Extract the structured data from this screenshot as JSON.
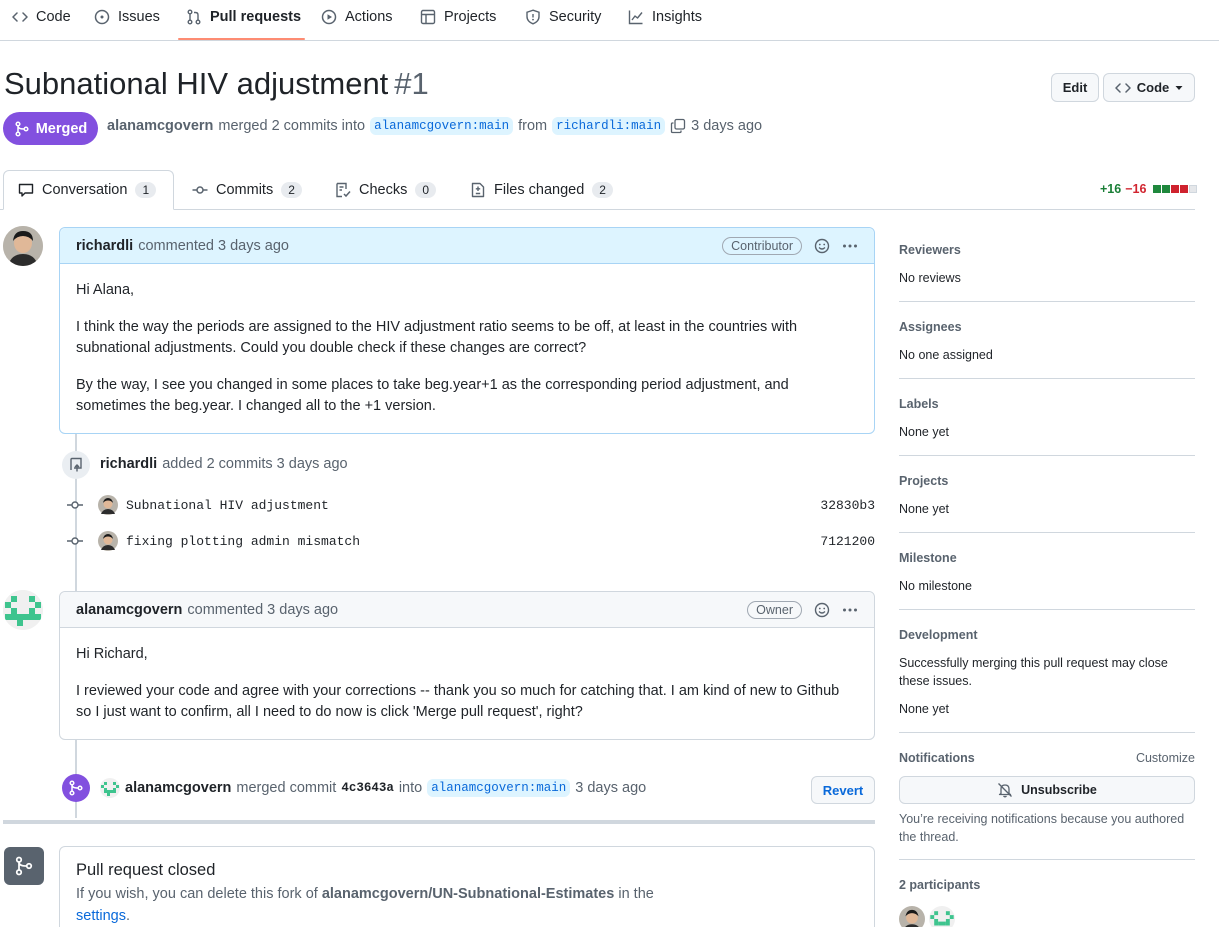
{
  "nav": {
    "items": [
      {
        "label": "Code",
        "icon": "code-icon"
      },
      {
        "label": "Issues",
        "icon": "issue-icon"
      },
      {
        "label": "Pull requests",
        "icon": "pull-request-icon",
        "active": true
      },
      {
        "label": "Actions",
        "icon": "play-icon"
      },
      {
        "label": "Projects",
        "icon": "table-icon"
      },
      {
        "label": "Security",
        "icon": "shield-icon"
      },
      {
        "label": "Insights",
        "icon": "graph-icon"
      }
    ]
  },
  "pr": {
    "title": "Subnational HIV adjustment",
    "number": "#1",
    "edit_label": "Edit",
    "code_label": "Code",
    "state_label": "Merged",
    "author": "alanamcgovern",
    "merge_text": "merged 2 commits into",
    "base_branch": "alanamcgovern:main",
    "from_text": "from",
    "head_branch": "richardli:main",
    "time": "3 days ago"
  },
  "tabs": [
    {
      "label": "Conversation",
      "count": "1",
      "icon": "comment-icon"
    },
    {
      "label": "Commits",
      "count": "2",
      "icon": "commit-icon"
    },
    {
      "label": "Checks",
      "count": "0",
      "icon": "checklist-icon"
    },
    {
      "label": "Files changed",
      "count": "2",
      "icon": "file-diff-icon"
    }
  ],
  "diffstat": {
    "additions": "+16",
    "deletions": "−16"
  },
  "comment1": {
    "author": "richardli",
    "action": "commented 3 days ago",
    "role": "Contributor",
    "paragraphs": [
      "Hi Alana,",
      "I think the way the periods are assigned to the HIV adjustment ratio seems to be off, at least in the countries with subnational adjustments. Could you double check if these changes are correct?",
      "By the way, I see you changed in some places to take beg.year+1 as the corresponding period adjustment, and sometimes the beg.year. I changed all to the +1 version."
    ]
  },
  "commits_event": {
    "author": "richardli",
    "text": "added 2 commits 3 days ago",
    "commits": [
      {
        "message": "Subnational HIV adjustment",
        "sha": "32830b3"
      },
      {
        "message": "fixing plotting admin mismatch",
        "sha": "7121200"
      }
    ]
  },
  "comment2": {
    "author": "alanamcgovern",
    "action": "commented 3 days ago",
    "role": "Owner",
    "paragraphs": [
      "Hi Richard,",
      "I reviewed your code and agree with your corrections -- thank you so much for catching that. I am kind of new to Github so I just want to confirm, all I need to do now is click 'Merge pull request', right?"
    ]
  },
  "merge_event": {
    "author": "alanamcgovern",
    "text": "merged commit",
    "sha": "4c3643a",
    "into": "into",
    "branch": "alanamcgovern:main",
    "time": "3 days ago",
    "revert_label": "Revert"
  },
  "closed": {
    "title": "Pull request closed",
    "text_before": "If you wish, you can delete this fork of",
    "repo": "alanamcgovern/UN-Subnational-Estimates",
    "text_after": "in the",
    "link": "settings",
    "period": "."
  },
  "sidebar": {
    "reviewers": {
      "label": "Reviewers",
      "value": "No reviews"
    },
    "assignees": {
      "label": "Assignees",
      "value": "No one assigned"
    },
    "labels": {
      "label": "Labels",
      "value": "None yet"
    },
    "projects": {
      "label": "Projects",
      "value": "None yet"
    },
    "milestone": {
      "label": "Milestone",
      "value": "No milestone"
    },
    "development": {
      "label": "Development",
      "text": "Successfully merging this pull request may close these issues.",
      "value": "None yet"
    },
    "notifications": {
      "label": "Notifications",
      "customize": "Customize",
      "button": "Unsubscribe",
      "text": "You’re receiving notifications because you authored the thread."
    },
    "participants": {
      "label": "2 participants"
    }
  },
  "colors": {
    "merged": "#8250df",
    "link": "#0969da",
    "add": "#1a7f37",
    "del": "#d1242f"
  }
}
